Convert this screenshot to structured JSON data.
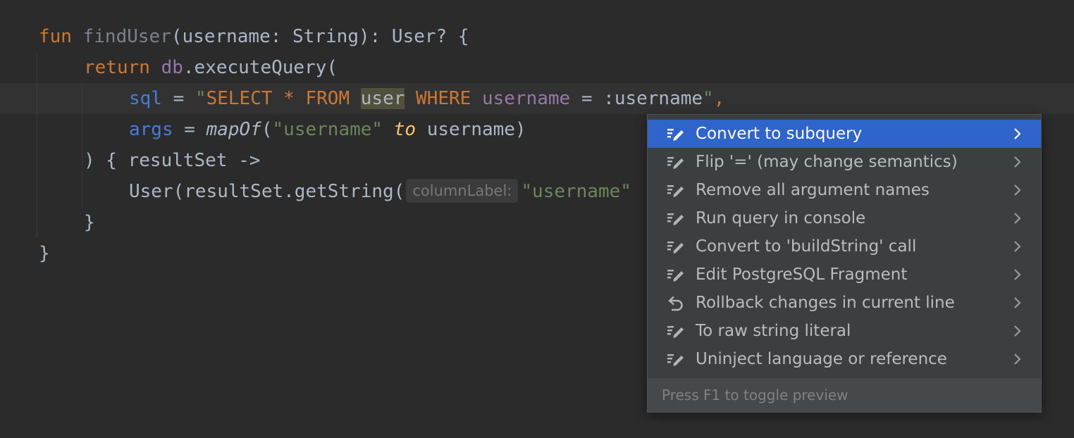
{
  "editor": {
    "line1": {
      "kw_fun": "fun",
      "fn_name": "findUser",
      "params": "(username: String): User? {"
    },
    "line2": {
      "kw_return": "return",
      "receiver": "db",
      "call": ".executeQuery("
    },
    "line3": {
      "param": "sql",
      "eq": " = ",
      "q_open": "\"",
      "sql_select": "SELECT",
      "sql_star": " * ",
      "sql_from": "FROM",
      "space": " ",
      "sql_table": "user",
      "sql_where": " WHERE ",
      "sql_col": "username",
      "sql_rest": " = :username",
      "q_close": "\"",
      "comma": ","
    },
    "line4": {
      "param": "args",
      "eq": " = ",
      "fn": "mapOf",
      "open": "(",
      "str": "\"username\"",
      "infix": " to",
      "rest": " username)"
    },
    "line5": {
      "text": ") { resultSet ->"
    },
    "line6": {
      "prefix": "User(resultSet.getString(",
      "hint": "columnLabel:",
      "str": "\"username\""
    },
    "line7": {
      "text": "}"
    },
    "line8": {
      "text": "}"
    }
  },
  "popup": {
    "items": [
      {
        "label": "Convert to subquery",
        "icon": "intention-icon",
        "selected": true
      },
      {
        "label": "Flip '=' (may change semantics)",
        "icon": "intention-icon"
      },
      {
        "label": "Remove all argument names",
        "icon": "intention-icon"
      },
      {
        "label": "Run query in console",
        "icon": "intention-icon"
      },
      {
        "label": "Convert to 'buildString' call",
        "icon": "intention-icon"
      },
      {
        "label": "Edit PostgreSQL Fragment",
        "icon": "intention-icon"
      },
      {
        "label": "Rollback changes in current line",
        "icon": "undo-icon"
      },
      {
        "label": "To raw string literal",
        "icon": "intention-icon"
      },
      {
        "label": "Uninject language or reference",
        "icon": "intention-icon"
      }
    ],
    "footer": "Press F1 to toggle preview"
  },
  "colors": {
    "background": "#2b2b2b",
    "keyword": "#cc7832",
    "string": "#6a8759",
    "selection": "#2f65ca",
    "popup_bg": "#3c3f41"
  }
}
